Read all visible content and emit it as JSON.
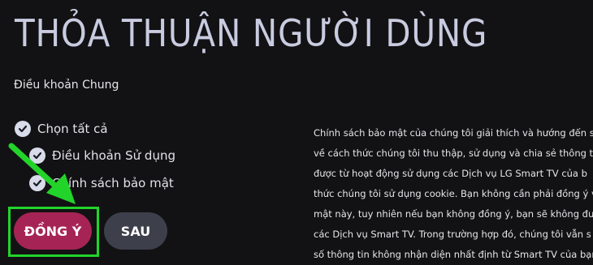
{
  "header": {
    "title": "THỎA THUẬN NGƯỜI DÙNG",
    "subtitle": "Điều khoản Chung"
  },
  "checklist": {
    "select_all": "Chọn tất cả",
    "items": [
      {
        "label": "Điều khoản Sử dụng"
      },
      {
        "label": "Chính sách bảo mật"
      }
    ]
  },
  "body_lines": [
    "Chính sách bảo mật của chúng tôi giải thích và hướng đến s",
    "về cách thức chúng tôi thu thập, sử dụng và chia sẻ thông ti",
    "được từ hoạt động sử dụng các Dịch vụ LG Smart TV của b",
    "thức chúng tôi sử dụng cookie. Bạn không cần phải đồng ý v",
    "mật này, tuy nhiên nếu bạn không đồng ý, bạn sẽ không đư",
    "các Dịch vụ Smart TV. Trong trường hợp đó, chúng tôi vẫn s",
    "số thông tin không nhận diện nhất định từ Smart TV của bạn"
  ],
  "buttons": {
    "agree": "ĐỒNG Ý",
    "later": "SAU"
  },
  "colors": {
    "background": "#121214",
    "agree_button": "#a62455",
    "later_button": "#3d3f4b",
    "highlight": "#22d42a"
  }
}
